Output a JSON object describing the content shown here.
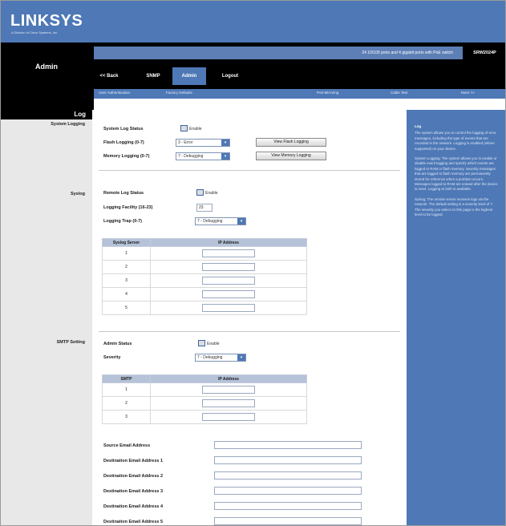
{
  "brand": {
    "logo": "LINKSYS",
    "tagline": "A Division of Cisco Systems, Inc."
  },
  "header": {
    "section_title": "Admin",
    "model_description": "24 10/100 ports and 4 gigabit ports with PoE switch",
    "model_code": "SRW2024P"
  },
  "tabs": [
    {
      "label": "<< Back"
    },
    {
      "label": "SNMP"
    },
    {
      "label": "Admin"
    },
    {
      "label": "Logout"
    }
  ],
  "subnav": [
    "User Authentication",
    "Factory Defaults",
    "Port Mirroring",
    "Cable Test",
    "More >>"
  ],
  "page": {
    "title": "Log",
    "sections": {
      "system_logging": "System Logging",
      "syslog": "Syslog",
      "smtp_setting": "SMTP Setting"
    }
  },
  "system_logging": {
    "status_label": "System Log Status",
    "status_value": "Enable",
    "flash_label": "Flash Logging (0-7)",
    "flash_value": "3 - Error",
    "memory_label": "Memory Logging (0-7)",
    "memory_value": "7 - Debugging",
    "view_flash_button": "View Flash Logging",
    "view_memory_button": "View Memory Logging"
  },
  "syslog": {
    "remote_label": "Remote Log Status",
    "remote_value": "Enable",
    "facility_label": "Logging Facility (16-23)",
    "facility_value": "23",
    "trap_label": "Logging Trap (0-7)",
    "trap_value": "7 - Debugging",
    "table_headers": [
      "Syslog Server",
      "IP Address"
    ],
    "rows": [
      "1",
      "2",
      "3",
      "4",
      "5"
    ]
  },
  "smtp": {
    "admin_status_label": "Admin Status",
    "admin_status_value": "Enable",
    "severity_label": "Severity",
    "severity_value": "7 - Debugging",
    "table_headers": [
      "SMTP",
      "IP Address"
    ],
    "rows": [
      "1",
      "2",
      "3"
    ],
    "email_fields": [
      "Source Email Address",
      "Destination Email Address 1",
      "Destination Email Address 2",
      "Destination Email Address 3",
      "Destination Email Address 4",
      "Destination Email Address 5"
    ]
  },
  "help": {
    "heading": "Log",
    "paragraphs": [
      "The system allows you to control the logging of error messages, including the type of events that are recorded in the network. Logging is enabled (where supported) on your device.",
      "System Logging: The system allows you to enable or disable event logging and specify which events are logged to RAM or flash memory. Severity messages that are logged to flash memory are permanently stored for reference when a problem occurs. Messages logged to RAM are erased after the device is reset. Logging to both is available.",
      "Syslog: The remote server receives logs via the network. The default setting is a severity level of 7. The severity you select on this page is the highest level to be logged."
    ]
  }
}
